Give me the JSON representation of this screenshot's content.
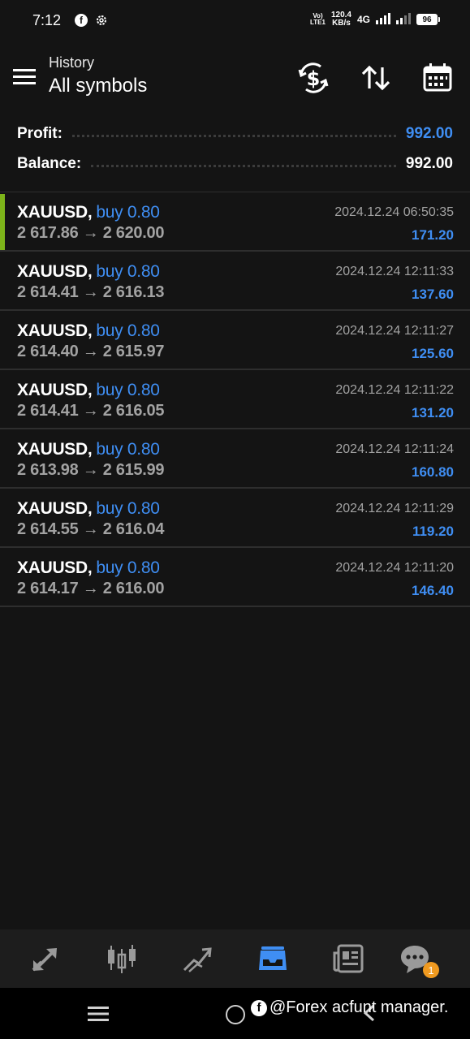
{
  "status_bar": {
    "time": "7:12",
    "volte_line1": "Vo)",
    "volte_line2": "LTE1",
    "net_speed_value": "120.4",
    "net_speed_unit": "KB/s",
    "network": "4G",
    "battery": "96"
  },
  "header": {
    "subtitle": "History",
    "title": "All symbols",
    "icons": [
      "menu-icon",
      "currency-exchange-icon",
      "sort-icon",
      "calendar-icon"
    ]
  },
  "summary": {
    "profit_label": "Profit:",
    "profit_value": "992.00",
    "balance_label": "Balance:",
    "balance_value": "992.00"
  },
  "deals": [
    {
      "symbol": "XAUUSD,",
      "side": "buy 0.80",
      "open_price": "2 617.86",
      "close_price": "2 620.00",
      "time": "2024.12.24 06:50:35",
      "profit": "171.20"
    },
    {
      "symbol": "XAUUSD,",
      "side": "buy 0.80",
      "open_price": "2 614.41",
      "close_price": "2 616.13",
      "time": "2024.12.24 12:11:33",
      "profit": "137.60"
    },
    {
      "symbol": "XAUUSD,",
      "side": "buy 0.80",
      "open_price": "2 614.40",
      "close_price": "2 615.97",
      "time": "2024.12.24 12:11:27",
      "profit": "125.60"
    },
    {
      "symbol": "XAUUSD,",
      "side": "buy 0.80",
      "open_price": "2 614.41",
      "close_price": "2 616.05",
      "time": "2024.12.24 12:11:22",
      "profit": "131.20"
    },
    {
      "symbol": "XAUUSD,",
      "side": "buy 0.80",
      "open_price": "2 613.98",
      "close_price": "2 615.99",
      "time": "2024.12.24 12:11:24",
      "profit": "160.80"
    },
    {
      "symbol": "XAUUSD,",
      "side": "buy 0.80",
      "open_price": "2 614.55",
      "close_price": "2 616.04",
      "time": "2024.12.24 12:11:29",
      "profit": "119.20"
    },
    {
      "symbol": "XAUUSD,",
      "side": "buy 0.80",
      "open_price": "2 614.17",
      "close_price": "2 616.00",
      "time": "2024.12.24 12:11:20",
      "profit": "146.40"
    }
  ],
  "arrow": "→",
  "bottom_nav": {
    "items": [
      "quotes-icon",
      "candlestick-chart-icon",
      "trade-icon",
      "history-icon",
      "news-icon",
      "chat-icon"
    ],
    "active": "history-icon",
    "chat_badge": "1"
  },
  "watermark": {
    "fb_glyph": "f",
    "text": "@Forex acfunt manager."
  },
  "colors": {
    "background": "#141414",
    "accent_blue": "#3f8ef3",
    "muted_text": "#a2a2a2",
    "active_marker": "#7db41a",
    "badge": "#f09a20"
  }
}
